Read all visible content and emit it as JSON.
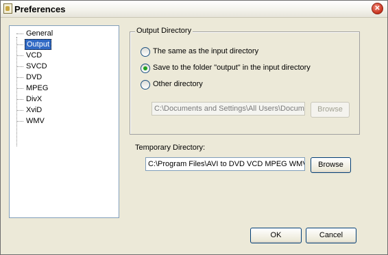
{
  "window": {
    "title": "Preferences"
  },
  "tree": {
    "items": [
      "General",
      "Output",
      "VCD",
      "SVCD",
      "DVD",
      "MPEG",
      "DivX",
      "XviD",
      "WMV"
    ],
    "selected": "Output"
  },
  "output_directory": {
    "legend": "Output Directory",
    "options": [
      {
        "label": "The same as the input directory",
        "checked": false
      },
      {
        "label": "Save to the folder \"output\" in the input directory",
        "checked": true
      },
      {
        "label": "Other directory",
        "checked": false
      }
    ],
    "path_value": "C:\\Documents and Settings\\All Users\\Docum",
    "browse_label": "Browse"
  },
  "temporary_directory": {
    "label": "Temporary Directory:",
    "path_value": "C:\\Program Files\\AVI to DVD VCD MPEG WMV",
    "browse_label": "Browse"
  },
  "buttons": {
    "ok": "OK",
    "cancel": "Cancel"
  }
}
